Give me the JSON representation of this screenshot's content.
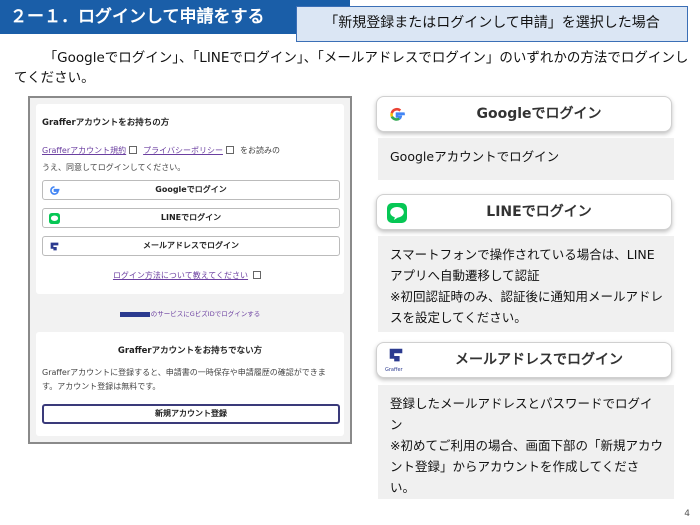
{
  "header": {
    "title": "２ー１．ログインして申請をする",
    "scenario": "「新規登録またはログインして申請」を選択した場合"
  },
  "intro": "「Googleでログイン」、「LINEでログイン」、「メールアドレスでログイン」のいずれかの方法でログインしてください。",
  "mock": {
    "account_heading": "Grafferアカウントをお持ちの方",
    "terms_link": "Grafferアカウント規約",
    "privacy_link": "プライバシーポリシー",
    "terms_suffix": "をお読みの",
    "terms_line2": "うえ、同意してログインしてください。",
    "google_button": "Googleでログイン",
    "line_button": "LINEでログイン",
    "mail_button": "メールアドレスでログイン",
    "howto_link": "ログイン方法について教えてください",
    "gbiz_link": "のサービスにGビズIDでログインする",
    "no_account_heading": "Grafferアカウントをお持ちでない方",
    "no_account_text": "Grafferアカウントに登録すると、申請書の一時保存や申請履歴の確認ができます。アカウント登録は無料です。",
    "register_button": "新規アカウント登録"
  },
  "right": {
    "google_label": "Googleでログイン",
    "google_desc": "Googleアカウントでログイン",
    "line_label": "LINEでログイン",
    "line_desc_1": "スマートフォンで操作されている場合は、LINEアプリへ自動遷移して認証",
    "line_desc_2": "※初回認証時のみ、認証後に通知用メールアドレスを設定してください。",
    "mail_label": "メールアドレスでログイン",
    "mail_brand": "Graffer",
    "mail_desc_1": "登録したメールアドレスとパスワードでログイン",
    "mail_desc_2": "※初めてご利用の場合、画面下部の「新規アカウント登録」からアカウントを作成してください。"
  },
  "page_number": "4",
  "colors": {
    "title_bg": "#1a5ea8",
    "scenario_bg": "#dbe6f4",
    "link_purple": "#6b3fa0",
    "line_green": "#06c755",
    "graffer_navy": "#2b3a8f"
  }
}
